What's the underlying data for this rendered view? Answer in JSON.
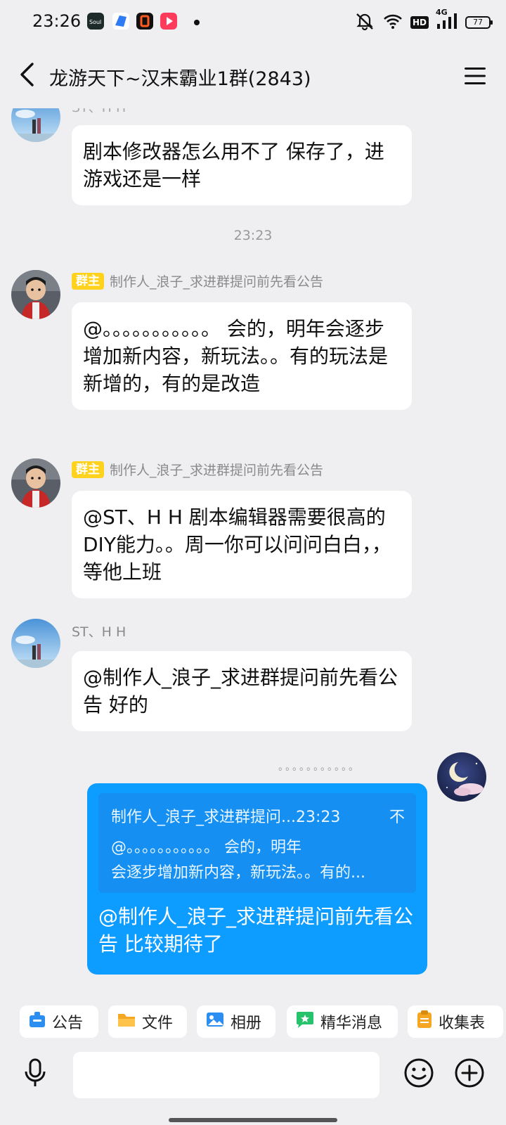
{
  "status_bar": {
    "time": "23:26",
    "network": "4G",
    "hd_label": "HD",
    "battery": "77",
    "app_icons": [
      "soul-app-icon",
      "blue-app-icon",
      "orange-app-icon",
      "video-app-icon"
    ]
  },
  "header": {
    "title": "龙游天下~汉末霸业1群(2843)"
  },
  "messages": [
    {
      "id": "m1",
      "sender": "ST、H H",
      "text": "剧本修改器怎么用不了 保存了，进游戏还是一样"
    },
    {
      "id": "m2",
      "badge": "群主",
      "sender": "制作人_浪子_求进群提问前先看公告",
      "text": "@。。。。。。。。。。。 会的，明年会逐步增加新内容，新玩法。。有的玩法是新增的，有的是改造"
    },
    {
      "id": "m3",
      "badge": "群主",
      "sender": "制作人_浪子_求进群提问前先看公告",
      "text": "@ST、H H 剧本编辑器需要很高的DIY能力。。周一你可以问问白白，，等他上班"
    },
    {
      "id": "m4",
      "sender": "ST、H H",
      "text": "@制作人_浪子_求进群提问前先看公告 好的"
    }
  ],
  "time_divider": "23:23",
  "my_message": {
    "sender_name": "。。。。。。。。。。。",
    "quote": {
      "header": "制作人_浪子_求进群提问...23:23",
      "close_label": "不",
      "line1": "@。。。。。。。。。。。 会的，明年",
      "line2": "会逐步增加新内容，新玩法。。有的..."
    },
    "text": "@制作人_浪子_求进群提问前先看公告 比较期待了"
  },
  "shortcuts": [
    {
      "label": "公告",
      "icon": "announcement-icon",
      "color": "#2b8ef0"
    },
    {
      "label": "文件",
      "icon": "folder-icon",
      "color": "#f5a623"
    },
    {
      "label": "相册",
      "icon": "album-icon",
      "color": "#2b8ef0"
    },
    {
      "label": "精华消息",
      "icon": "essence-icon",
      "color": "#27c26c"
    },
    {
      "label": "收集表",
      "icon": "form-icon",
      "color": "#f5a623"
    }
  ],
  "input": {
    "placeholder": ""
  }
}
